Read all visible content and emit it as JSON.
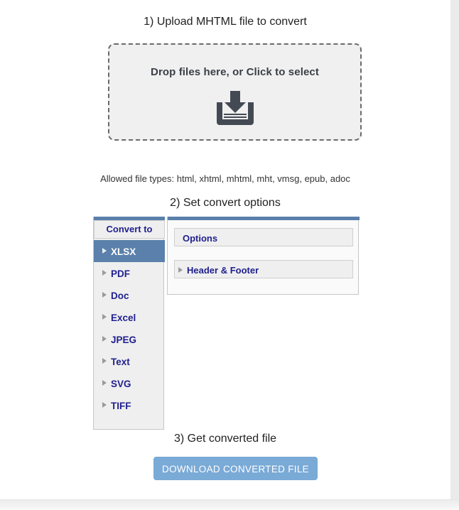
{
  "steps": {
    "step1": "1) Upload MHTML file to convert",
    "step2": "2) Set convert options",
    "step3": "3) Get converted file"
  },
  "dropzone": {
    "label": "Drop files here, or Click to select",
    "icon": "download-tray-icon"
  },
  "allowed_types": "Allowed file types: html, xhtml, mhtml, mht, vmsg, epub, adoc",
  "convert_to": {
    "header": "Convert to",
    "items": [
      {
        "label": "XLSX",
        "selected": true
      },
      {
        "label": "PDF",
        "selected": false
      },
      {
        "label": "Doc",
        "selected": false
      },
      {
        "label": "Excel",
        "selected": false
      },
      {
        "label": "JPEG",
        "selected": false
      },
      {
        "label": "Text",
        "selected": false
      },
      {
        "label": "SVG",
        "selected": false
      },
      {
        "label": "TIFF",
        "selected": false
      }
    ]
  },
  "options_panel": {
    "options_header": "Options",
    "header_footer_header": "Header & Footer"
  },
  "download": {
    "label": "DOWNLOAD CONVERTED FILE"
  },
  "colors": {
    "accent_blue": "#5a80ab",
    "button_blue": "#7aaad6",
    "link_blue": "#1f1f8f",
    "icon_slate": "#434a54",
    "dropzone_bg": "#f0f0f0",
    "panel_bg": "#efefef"
  }
}
